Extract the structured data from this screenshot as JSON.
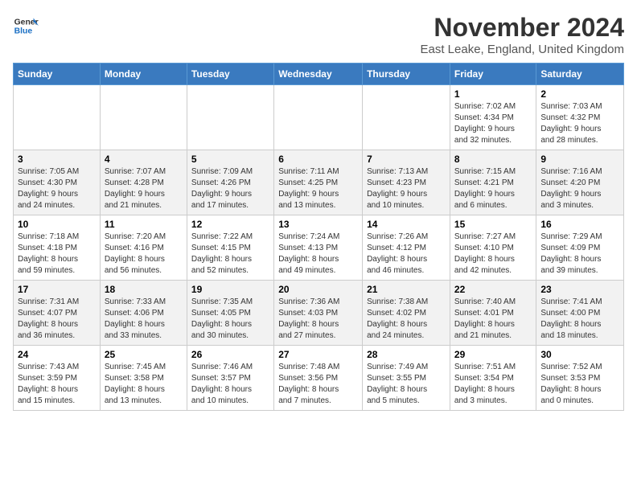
{
  "logo": {
    "line1": "General",
    "line2": "Blue"
  },
  "title": "November 2024",
  "location": "East Leake, England, United Kingdom",
  "days_of_week": [
    "Sunday",
    "Monday",
    "Tuesday",
    "Wednesday",
    "Thursday",
    "Friday",
    "Saturday"
  ],
  "weeks": [
    [
      {
        "day": "",
        "info": ""
      },
      {
        "day": "",
        "info": ""
      },
      {
        "day": "",
        "info": ""
      },
      {
        "day": "",
        "info": ""
      },
      {
        "day": "",
        "info": ""
      },
      {
        "day": "1",
        "info": "Sunrise: 7:02 AM\nSunset: 4:34 PM\nDaylight: 9 hours\nand 32 minutes."
      },
      {
        "day": "2",
        "info": "Sunrise: 7:03 AM\nSunset: 4:32 PM\nDaylight: 9 hours\nand 28 minutes."
      }
    ],
    [
      {
        "day": "3",
        "info": "Sunrise: 7:05 AM\nSunset: 4:30 PM\nDaylight: 9 hours\nand 24 minutes."
      },
      {
        "day": "4",
        "info": "Sunrise: 7:07 AM\nSunset: 4:28 PM\nDaylight: 9 hours\nand 21 minutes."
      },
      {
        "day": "5",
        "info": "Sunrise: 7:09 AM\nSunset: 4:26 PM\nDaylight: 9 hours\nand 17 minutes."
      },
      {
        "day": "6",
        "info": "Sunrise: 7:11 AM\nSunset: 4:25 PM\nDaylight: 9 hours\nand 13 minutes."
      },
      {
        "day": "7",
        "info": "Sunrise: 7:13 AM\nSunset: 4:23 PM\nDaylight: 9 hours\nand 10 minutes."
      },
      {
        "day": "8",
        "info": "Sunrise: 7:15 AM\nSunset: 4:21 PM\nDaylight: 9 hours\nand 6 minutes."
      },
      {
        "day": "9",
        "info": "Sunrise: 7:16 AM\nSunset: 4:20 PM\nDaylight: 9 hours\nand 3 minutes."
      }
    ],
    [
      {
        "day": "10",
        "info": "Sunrise: 7:18 AM\nSunset: 4:18 PM\nDaylight: 8 hours\nand 59 minutes."
      },
      {
        "day": "11",
        "info": "Sunrise: 7:20 AM\nSunset: 4:16 PM\nDaylight: 8 hours\nand 56 minutes."
      },
      {
        "day": "12",
        "info": "Sunrise: 7:22 AM\nSunset: 4:15 PM\nDaylight: 8 hours\nand 52 minutes."
      },
      {
        "day": "13",
        "info": "Sunrise: 7:24 AM\nSunset: 4:13 PM\nDaylight: 8 hours\nand 49 minutes."
      },
      {
        "day": "14",
        "info": "Sunrise: 7:26 AM\nSunset: 4:12 PM\nDaylight: 8 hours\nand 46 minutes."
      },
      {
        "day": "15",
        "info": "Sunrise: 7:27 AM\nSunset: 4:10 PM\nDaylight: 8 hours\nand 42 minutes."
      },
      {
        "day": "16",
        "info": "Sunrise: 7:29 AM\nSunset: 4:09 PM\nDaylight: 8 hours\nand 39 minutes."
      }
    ],
    [
      {
        "day": "17",
        "info": "Sunrise: 7:31 AM\nSunset: 4:07 PM\nDaylight: 8 hours\nand 36 minutes."
      },
      {
        "day": "18",
        "info": "Sunrise: 7:33 AM\nSunset: 4:06 PM\nDaylight: 8 hours\nand 33 minutes."
      },
      {
        "day": "19",
        "info": "Sunrise: 7:35 AM\nSunset: 4:05 PM\nDaylight: 8 hours\nand 30 minutes."
      },
      {
        "day": "20",
        "info": "Sunrise: 7:36 AM\nSunset: 4:03 PM\nDaylight: 8 hours\nand 27 minutes."
      },
      {
        "day": "21",
        "info": "Sunrise: 7:38 AM\nSunset: 4:02 PM\nDaylight: 8 hours\nand 24 minutes."
      },
      {
        "day": "22",
        "info": "Sunrise: 7:40 AM\nSunset: 4:01 PM\nDaylight: 8 hours\nand 21 minutes."
      },
      {
        "day": "23",
        "info": "Sunrise: 7:41 AM\nSunset: 4:00 PM\nDaylight: 8 hours\nand 18 minutes."
      }
    ],
    [
      {
        "day": "24",
        "info": "Sunrise: 7:43 AM\nSunset: 3:59 PM\nDaylight: 8 hours\nand 15 minutes."
      },
      {
        "day": "25",
        "info": "Sunrise: 7:45 AM\nSunset: 3:58 PM\nDaylight: 8 hours\nand 13 minutes."
      },
      {
        "day": "26",
        "info": "Sunrise: 7:46 AM\nSunset: 3:57 PM\nDaylight: 8 hours\nand 10 minutes."
      },
      {
        "day": "27",
        "info": "Sunrise: 7:48 AM\nSunset: 3:56 PM\nDaylight: 8 hours\nand 7 minutes."
      },
      {
        "day": "28",
        "info": "Sunrise: 7:49 AM\nSunset: 3:55 PM\nDaylight: 8 hours\nand 5 minutes."
      },
      {
        "day": "29",
        "info": "Sunrise: 7:51 AM\nSunset: 3:54 PM\nDaylight: 8 hours\nand 3 minutes."
      },
      {
        "day": "30",
        "info": "Sunrise: 7:52 AM\nSunset: 3:53 PM\nDaylight: 8 hours\nand 0 minutes."
      }
    ]
  ]
}
